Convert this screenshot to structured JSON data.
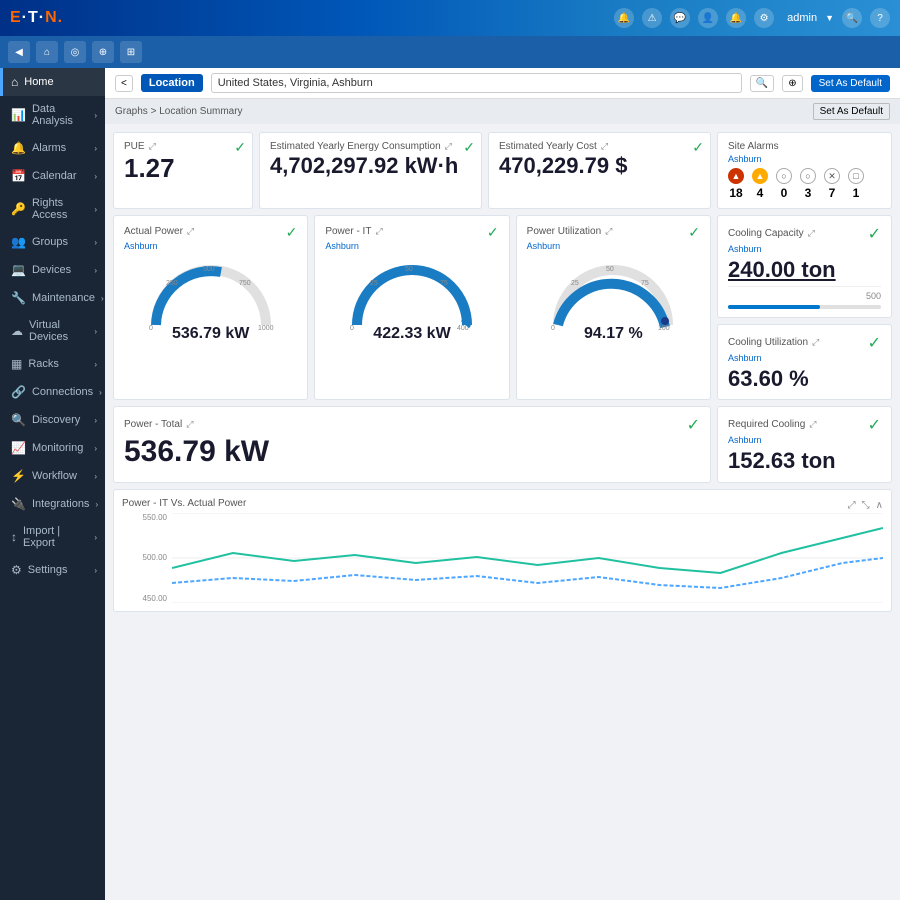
{
  "topbar": {
    "logo": "E·T·N",
    "logo_dot": "·",
    "user": "admin",
    "icons": [
      "bell",
      "warning",
      "chat",
      "user",
      "gear",
      "help"
    ]
  },
  "secondbar": {
    "icons": [
      "home",
      "chart",
      "circle",
      "tag"
    ]
  },
  "locationbar": {
    "back_label": "<",
    "location_label": "Location",
    "location_value": "United States, Virginia, Ashburn",
    "search_icon": "🔍",
    "set_default_label": "Set As Default"
  },
  "breadcrumb": {
    "path": "Graphs > Location Summary",
    "set_default_label": "Set As Default"
  },
  "sidebar": {
    "items": [
      {
        "label": "Home",
        "icon": "⌂",
        "active": true
      },
      {
        "label": "Data Analysis",
        "icon": "📊",
        "active": false
      },
      {
        "label": "Alarms",
        "icon": "🔔",
        "active": false
      },
      {
        "label": "Calendar",
        "icon": "📅",
        "active": false
      },
      {
        "label": "Rights Access",
        "icon": "🔑",
        "active": false
      },
      {
        "label": "Groups",
        "icon": "👥",
        "active": false
      },
      {
        "label": "Devices",
        "icon": "💻",
        "active": false
      },
      {
        "label": "Maintenance",
        "icon": "🔧",
        "active": false
      },
      {
        "label": "Virtual Devices",
        "icon": "☁",
        "active": false
      },
      {
        "label": "Racks",
        "icon": "▦",
        "active": false
      },
      {
        "label": "Connections",
        "icon": "🔗",
        "active": false
      },
      {
        "label": "Discovery",
        "icon": "🔍",
        "active": false
      },
      {
        "label": "Monitoring",
        "icon": "📈",
        "active": false
      },
      {
        "label": "Workflow",
        "icon": "⚡",
        "active": false
      },
      {
        "label": "Integrations",
        "icon": "🔌",
        "active": false
      },
      {
        "label": "Import | Export",
        "icon": "↕",
        "active": false
      },
      {
        "label": "Settings",
        "icon": "⚙",
        "active": false
      }
    ]
  },
  "cards": {
    "pue": {
      "title": "PUE",
      "expand_icon": "⤢",
      "value": "1.27",
      "check": "✓"
    },
    "energy": {
      "title": "Estimated Yearly Energy Consumption",
      "expand_icon": "⤢",
      "value": "4,702,297.92 kW·h",
      "check": "✓"
    },
    "cost": {
      "title": "Estimated Yearly Cost",
      "expand_icon": "⤢",
      "value": "470,229.79 $",
      "check": "✓"
    },
    "alarms": {
      "title": "Site Alarms",
      "subtitle": "Ashburn",
      "items": [
        {
          "type": "red",
          "count": "18",
          "icon": "▲"
        },
        {
          "type": "yellow",
          "count": "4",
          "icon": "▲"
        },
        {
          "type": "gray",
          "count": "0",
          "icon": "○"
        },
        {
          "type": "gray",
          "count": "3",
          "icon": "○"
        },
        {
          "type": "gray",
          "count": "7",
          "icon": "✕"
        },
        {
          "type": "gray",
          "count": "1",
          "icon": "□"
        }
      ]
    },
    "actual_power": {
      "title": "Actual Power",
      "expand_icon": "⤢",
      "subtitle": "Ashburn",
      "value": "536.79 kW",
      "gauge_min": "0",
      "gauge_max": "1000",
      "gauge_marks": [
        "0",
        "250",
        "500",
        "750",
        "1000"
      ],
      "gauge_percent": 53,
      "check": "✓"
    },
    "power_it": {
      "title": "Power - IT",
      "expand_icon": "⤢",
      "subtitle": "Ashburn",
      "value": "422.33 kW",
      "gauge_min": "0",
      "gauge_max": "400",
      "gauge_marks": [
        "0",
        "25",
        "50",
        "75",
        "400"
      ],
      "gauge_percent": 105,
      "check": "✓"
    },
    "power_util": {
      "title": "Power Utilization",
      "expand_icon": "⤢",
      "subtitle": "Ashburn",
      "value": "94.17 %",
      "gauge_min": "0",
      "gauge_max": "100",
      "gauge_marks": [
        "0",
        "25",
        "50",
        "75",
        "100"
      ],
      "gauge_percent": 94,
      "check": "✓"
    },
    "cooling_capacity": {
      "title": "Cooling Capacity",
      "expand_icon": "⤢",
      "subtitle": "Ashburn",
      "value": "240.00 ton",
      "bar_label": "500",
      "check": "✓"
    },
    "cooling_util": {
      "title": "Cooling Utilization",
      "expand_icon": "⤢",
      "subtitle": "Ashburn",
      "value": "63.60 %",
      "check": "✓"
    },
    "power_total": {
      "title": "Power - Total",
      "expand_icon": "⤢",
      "value": "536.79 kW",
      "check": "✓"
    },
    "required_cooling": {
      "title": "Required Cooling",
      "expand_icon": "⤢",
      "subtitle": "Ashburn",
      "value": "152.63 ton",
      "check": "✓"
    }
  },
  "chart": {
    "title": "Power - IT Vs. Actual Power",
    "y_max": "550.00",
    "y_mid": "500.00",
    "y_min": "450.00",
    "icons": [
      "⤢",
      "⤡",
      "∧"
    ]
  }
}
